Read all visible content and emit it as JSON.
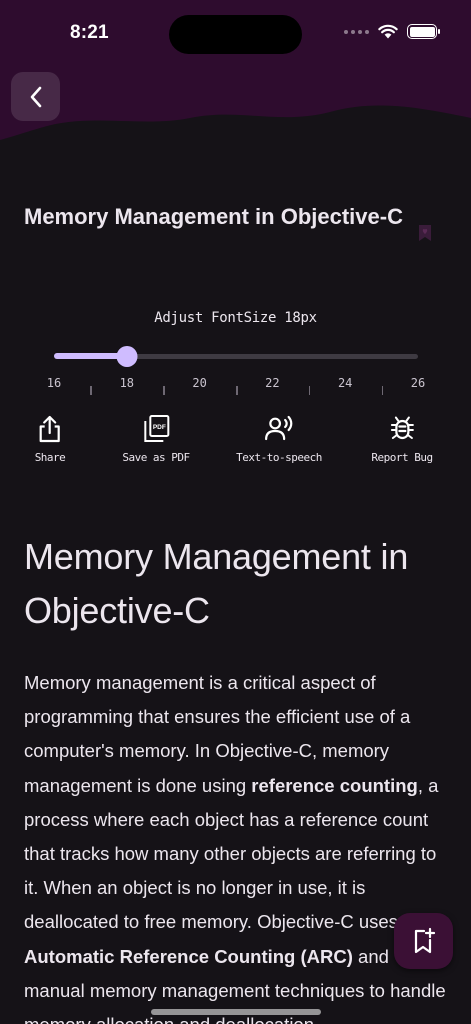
{
  "status_bar": {
    "time": "8:21"
  },
  "header": {
    "back_icon": "chevron-left-icon",
    "brand_color": "#3A0F3A"
  },
  "title_card": {
    "title": "Memory Management in Objective-C",
    "favorite_icon": "bookmark-heart-icon"
  },
  "font_size": {
    "label": "Adjust FontSize 18px",
    "value": 18,
    "min": 16,
    "max": 26,
    "tick_labels": [
      "16",
      "18",
      "20",
      "22",
      "24",
      "26"
    ],
    "accent": "#CFBCFF"
  },
  "actions": [
    {
      "label": "Share",
      "icon": "share-icon"
    },
    {
      "label": "Save as PDF",
      "icon": "pdf-icon"
    },
    {
      "label": "Text-to-speech",
      "icon": "speaker-icon"
    },
    {
      "label": "Report Bug",
      "icon": "bug-icon"
    }
  ],
  "article": {
    "heading": "Memory Management in Objective-C",
    "p1_a": "Memory management is a critical aspect of programming that ensures the efficient use of a computer's memory. In Objective-C, memory management is done using ",
    "p1_b": "reference counting",
    "p1_c": ", a process where each object has a reference count that tracks how many other objects are referring to it. When an object is no longer in use, it is deallocated to free memory. Objective-C uses ",
    "p1_d": "Automatic Reference Counting (ARC)",
    "p1_e": " and manual memory management techniques to handle memory allocation and deallocation."
  },
  "fab": {
    "icon": "bookmark-add-icon",
    "color": "#3B1035"
  }
}
